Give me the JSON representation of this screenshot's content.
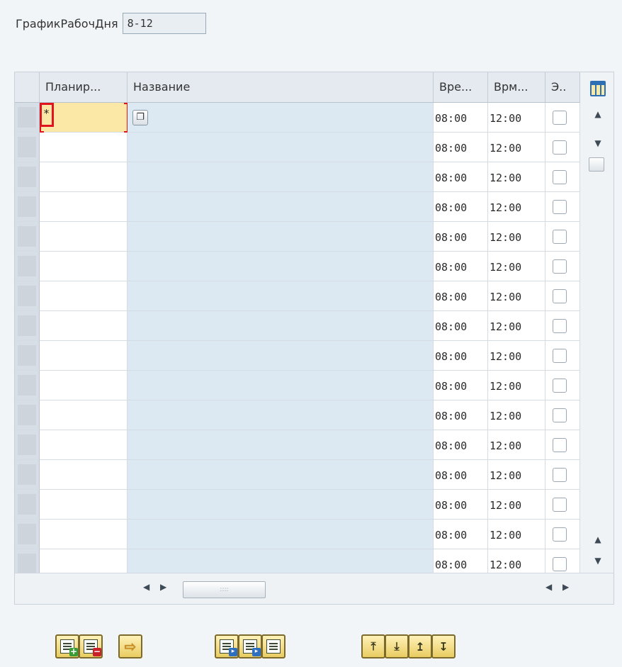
{
  "header": {
    "label": "ГрафикРабочДня",
    "value": "8-12"
  },
  "table": {
    "columns": [
      "Планир...",
      "Название",
      "Вре...",
      "Врм...",
      "Э.."
    ],
    "first_row_plan_value": "*",
    "rows": [
      {
        "start": "08:00",
        "end": "12:00"
      },
      {
        "start": "08:00",
        "end": "12:00"
      },
      {
        "start": "08:00",
        "end": "12:00"
      },
      {
        "start": "08:00",
        "end": "12:00"
      },
      {
        "start": "08:00",
        "end": "12:00"
      },
      {
        "start": "08:00",
        "end": "12:00"
      },
      {
        "start": "08:00",
        "end": "12:00"
      },
      {
        "start": "08:00",
        "end": "12:00"
      },
      {
        "start": "08:00",
        "end": "12:00"
      },
      {
        "start": "08:00",
        "end": "12:00"
      },
      {
        "start": "08:00",
        "end": "12:00"
      },
      {
        "start": "08:00",
        "end": "12:00"
      },
      {
        "start": "08:00",
        "end": "12:00"
      },
      {
        "start": "08:00",
        "end": "12:00"
      },
      {
        "start": "08:00",
        "end": "12:00"
      },
      {
        "start": "08:00",
        "end": "12:00"
      }
    ]
  },
  "icons": {
    "column_settings": "table-settings-icon",
    "value_help": "value-help-icon",
    "toolbar": [
      "insert-row-icon",
      "delete-row-icon",
      "copy-row-icon",
      "select-all-icon",
      "select-block-icon",
      "deselect-all-icon",
      "sort-ascending-icon",
      "sort-descending-icon",
      "sort-up-icon",
      "sort-down-icon"
    ]
  },
  "colors": {
    "focus": "#e0141e",
    "input_highlight": "#fbe8a6",
    "name_column": "#dce8f2"
  }
}
